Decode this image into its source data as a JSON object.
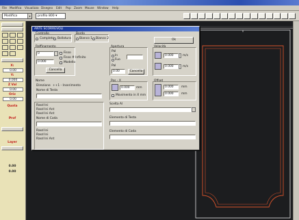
{
  "menubar": [
    "File",
    "Modifica",
    "Visualizza",
    "Disegno",
    "Edit",
    "Pop",
    "Zoom",
    "Mouse",
    "Window",
    "Help"
  ],
  "toolbar": {
    "combo1": "Modifica",
    "combo2": "profilo 800 ▾",
    "combo_arrow": "▾"
  },
  "left_panel": {
    "red_labels": [
      "X:",
      "Y:",
      "Z Val",
      "Oriz",
      "Quota",
      "Prof",
      "Layer"
    ],
    "values": [
      "0.00",
      "0.000",
      "0.00",
      "0.00"
    ],
    "bottom_values": [
      "0.00",
      "0.00"
    ]
  },
  "dialog": {
    "title": "ANTE SCORREVOLI",
    "controllo": {
      "title": "Controllo",
      "opt1": "Completo",
      "opt2": "Bollatura"
    },
    "bordo": {
      "title": "Bordo",
      "opt1": "Bianco 1",
      "opt2": "Bianco 2"
    },
    "ok_label": "Ok",
    "raffinamento": {
      "title": "Raffinamento",
      "value1": "0",
      "value2": "0.000",
      "check1": "Fisso",
      "check2": "Fisso # Infinito",
      "check3": "Modello",
      "cancel_label": "Cancella"
    },
    "apertura": {
      "title": "Apertura",
      "label1": "Pal",
      "opt1": "In",
      "opt2": "Fuo",
      "label2": "Pal",
      "value": "0.00",
      "button": "Cancella"
    },
    "velocita": {
      "title": "Velocità",
      "value1": "0.000",
      "unit1": "m/s",
      "value2": "0.000",
      "unit2": "m/s"
    },
    "nome": {
      "title": "Nome",
      "label": "Direzione",
      "value": "++1 - Inserimento",
      "field_label": "Nome di Testa"
    },
    "pos_x": {
      "title": "Pos - X",
      "value": "0.000",
      "unit": "mm",
      "check": "Movimento in X mm"
    },
    "offset": {
      "title": "Offset",
      "value1": "0.000",
      "unit1": "mm",
      "value2": "0.000",
      "unit2": "mm"
    },
    "lists": {
      "left_top": [
        "Rasd Ini",
        "Rasd Ini Ant",
        "Rasd Ini Ant"
      ],
      "left_label": "Nome di Coda",
      "left_bottom": [
        "Rasd Ini",
        "Rasd Ini",
        "Rasd Ini Ant"
      ]
    },
    "bottom_right": {
      "label1": "Scelta Al",
      "label2": "Elemento di Testa",
      "label3": "Elemento di Coda"
    }
  }
}
